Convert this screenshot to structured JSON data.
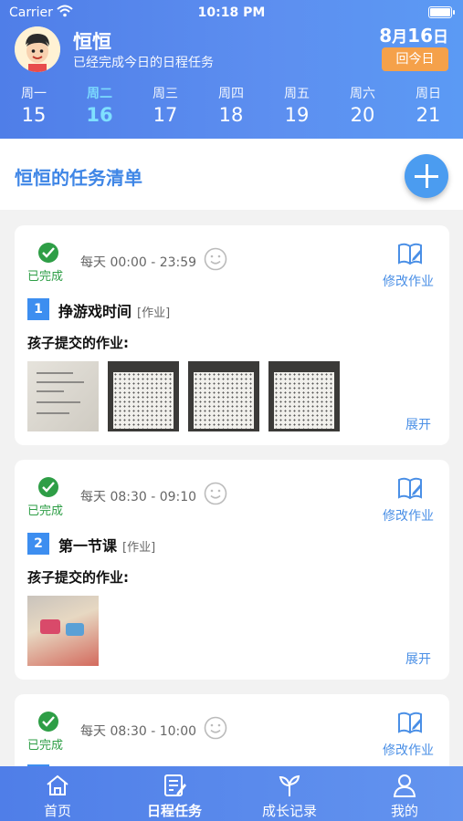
{
  "status_bar": {
    "carrier": "Carrier",
    "time": "10:18 PM"
  },
  "profile": {
    "name": "恒恒",
    "subtitle": "已经完成今日的日程任务"
  },
  "date": {
    "month": "8",
    "month_unit": "月",
    "day": "16",
    "day_unit": "日",
    "today_button": "回今日"
  },
  "week": [
    {
      "label": "周一",
      "date": "15"
    },
    {
      "label": "周二",
      "date": "16"
    },
    {
      "label": "周三",
      "date": "17"
    },
    {
      "label": "周四",
      "date": "18"
    },
    {
      "label": "周五",
      "date": "19"
    },
    {
      "label": "周六",
      "date": "20"
    },
    {
      "label": "周日",
      "date": "21"
    }
  ],
  "list": {
    "title": "恒恒的任务清单"
  },
  "tasks": [
    {
      "status": "已完成",
      "schedule": "每天 00:00 - 23:59",
      "edit_label": "修改作业",
      "number": "1",
      "name": "挣游戏时间",
      "tag": "[作业]",
      "submitted_label": "孩子提交的作业:",
      "expand_label": "展开"
    },
    {
      "status": "已完成",
      "schedule": "每天 08:30 - 09:10",
      "edit_label": "修改作业",
      "number": "2",
      "name": "第一节课",
      "tag": "[作业]",
      "submitted_label": "孩子提交的作业:",
      "expand_label": "展开"
    },
    {
      "status": "已完成",
      "schedule": "每天 08:30 - 10:00",
      "edit_label": "修改作业"
    }
  ],
  "tabs": [
    {
      "label": "首页",
      "icon": "home-icon"
    },
    {
      "label": "日程任务",
      "icon": "schedule-icon"
    },
    {
      "label": "成长记录",
      "icon": "sprout-icon"
    },
    {
      "label": "我的",
      "icon": "profile-icon"
    }
  ],
  "colors": {
    "header": "#5b8cee",
    "accent": "#3f86e6",
    "done": "#2e9e46",
    "today_button": "#f5a14a"
  }
}
